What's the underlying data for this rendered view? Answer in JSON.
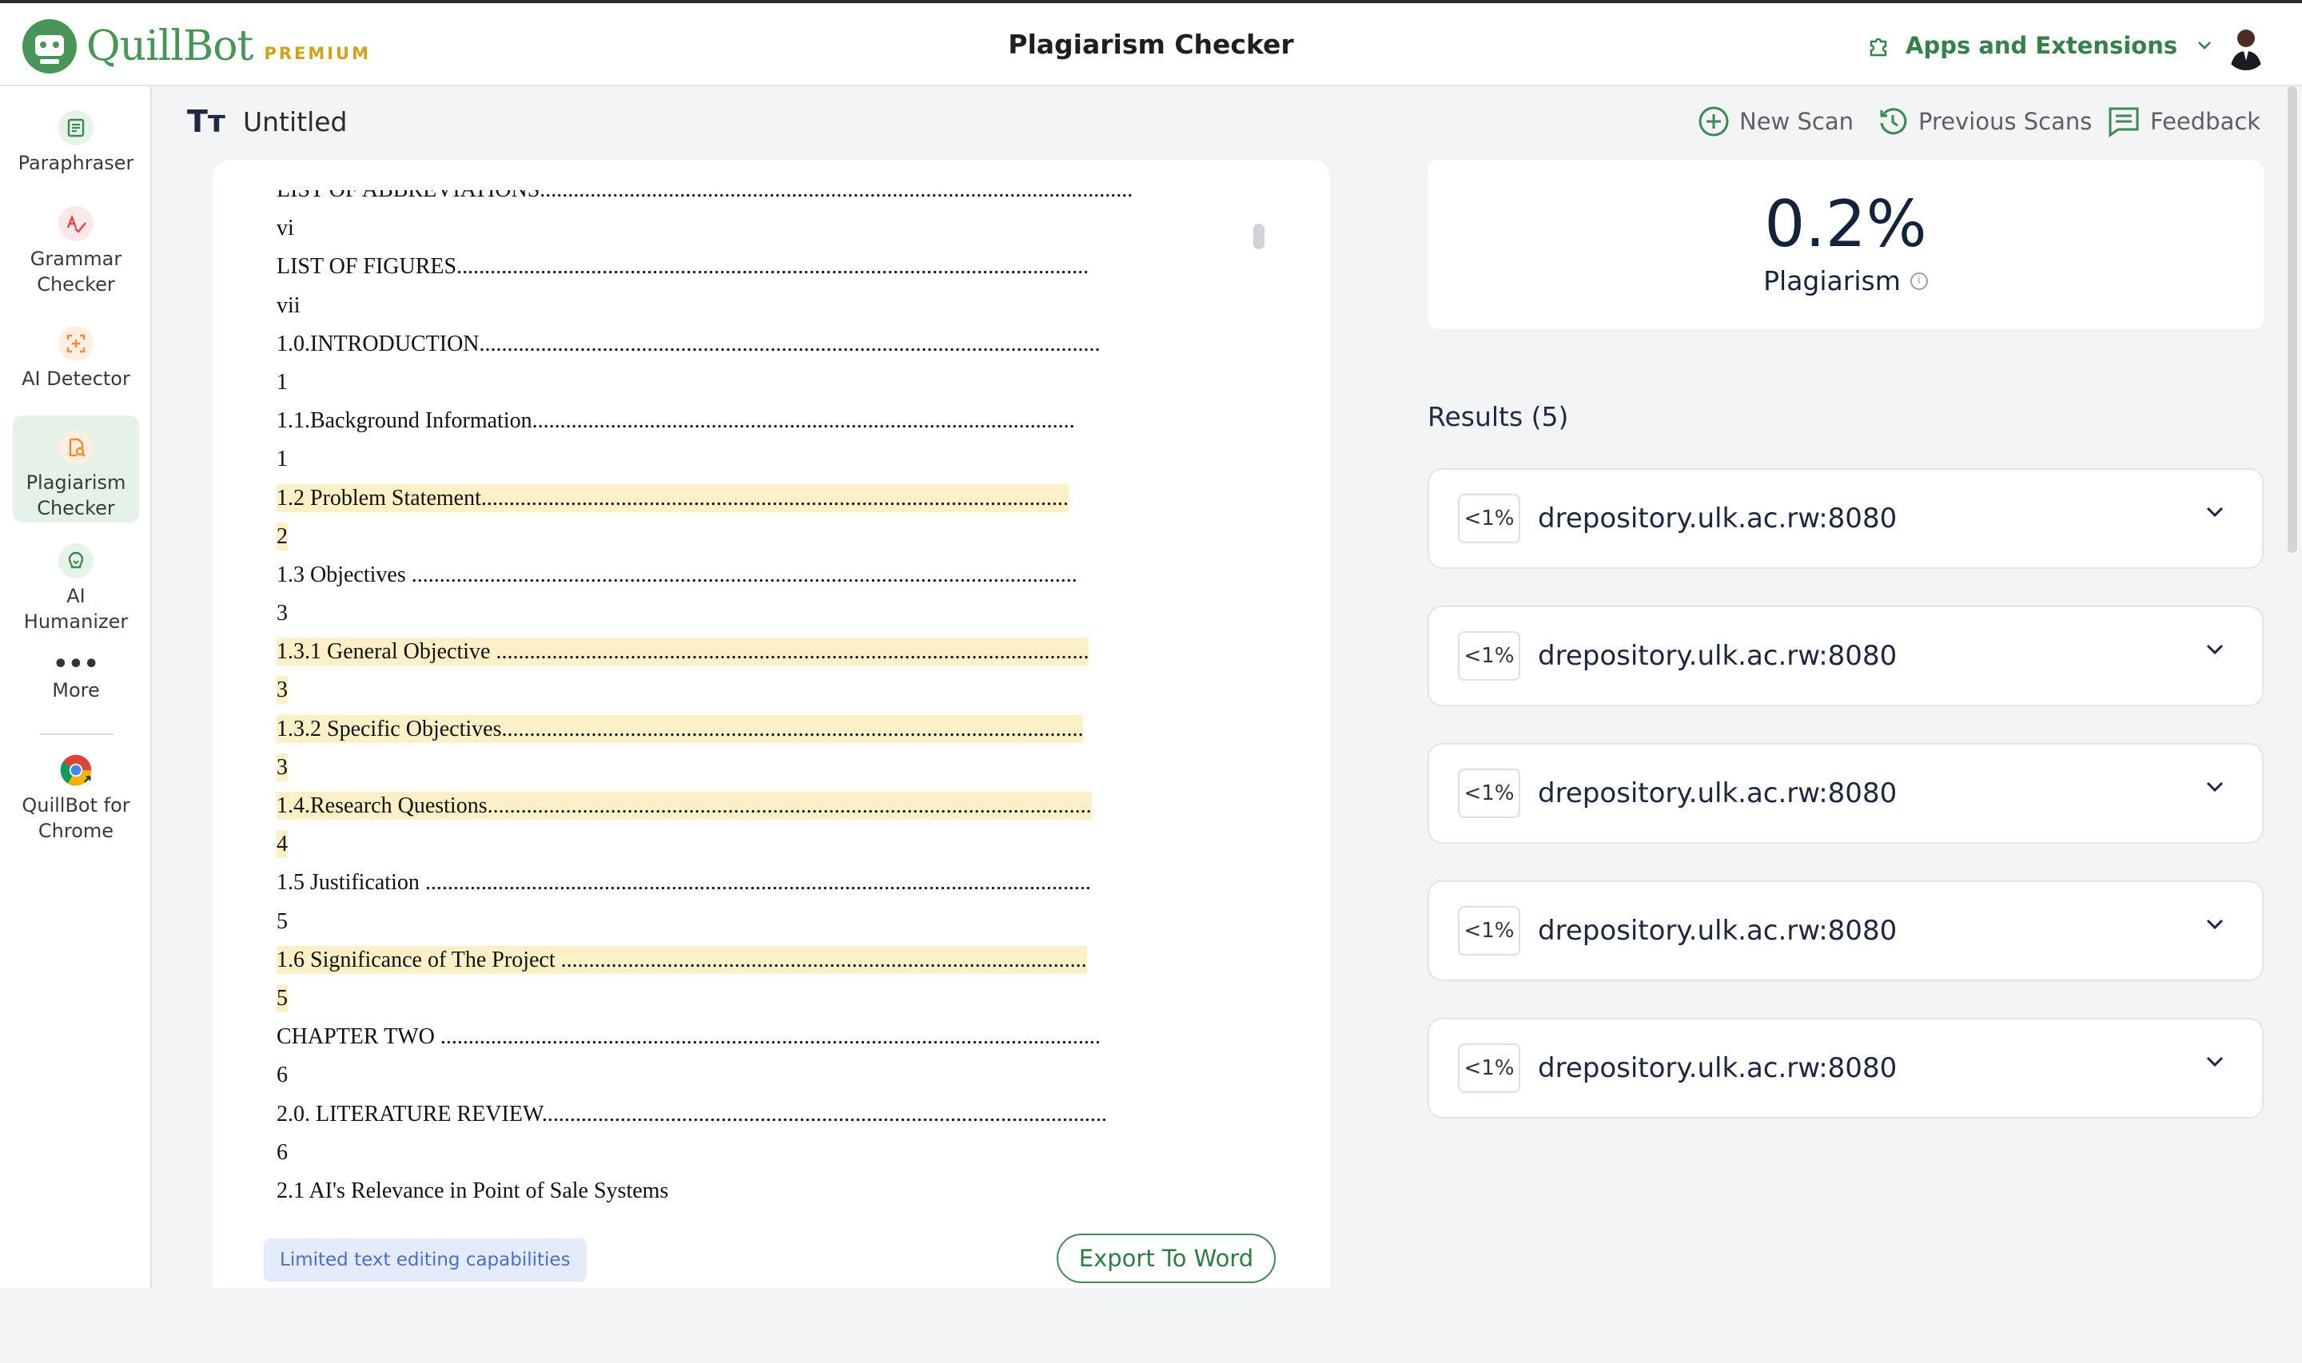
{
  "app": {
    "brand": "QuillBot",
    "premium": "PREMIUM",
    "page_title": "Plagiarism Checker",
    "apps_label": "Apps and Extensions"
  },
  "sidebar": {
    "items": [
      {
        "label": "Paraphraser",
        "icon": "paraphraser-icon"
      },
      {
        "label": "Grammar Checker",
        "icon": "grammar-checker-icon"
      },
      {
        "label": "AI Detector",
        "icon": "ai-detector-icon"
      },
      {
        "label": "Plagiarism Checker",
        "icon": "plagiarism-checker-icon",
        "active": true
      },
      {
        "label": "AI Humanizer",
        "icon": "ai-humanizer-icon"
      },
      {
        "label": "More",
        "icon": "more-dots-icon"
      },
      {
        "label": "QuillBot for Chrome",
        "icon": "chrome-icon"
      }
    ]
  },
  "document": {
    "title_icon": "Tт",
    "title": "Untitled",
    "lines": [
      {
        "text": "LIST OF ABBREVIATIONS..........................................................................................................",
        "hl": false
      },
      {
        "text": "vi",
        "hl": false
      },
      {
        "text": "LIST OF FIGURES.................................................................................................................",
        "hl": false
      },
      {
        "text": "vii",
        "hl": false
      },
      {
        "text": "1.0.INTRODUCTION...............................................................................................................",
        "hl": false
      },
      {
        "text": "1",
        "hl": false
      },
      {
        "text": "1.1.Background Information.................................................................................................",
        "hl": false
      },
      {
        "text": "1",
        "hl": false
      },
      {
        "text": "1.2 Problem Statement.........................................................................................................",
        "hl": true
      },
      {
        "text": "2",
        "hl": true
      },
      {
        "text": "1.3 Objectives .......................................................................................................................",
        "hl": false
      },
      {
        "text": "3",
        "hl": false
      },
      {
        "text": "1.3.1 General Objective ..........................................................................................................",
        "hl": true
      },
      {
        "text": "3",
        "hl": true
      },
      {
        "text": "1.3.2 Specific Objectives........................................................................................................",
        "hl": true
      },
      {
        "text": "3",
        "hl": true
      },
      {
        "text": "1.4.Research Questions............................................................................................................",
        "hl": true
      },
      {
        "text": "4",
        "hl": true
      },
      {
        "text": "1.5 Justification .......................................................................................................................",
        "hl": false
      },
      {
        "text": "5",
        "hl": false
      },
      {
        "text": "1.6 Significance of The Project ..............................................................................................",
        "hl": true
      },
      {
        "text": "5",
        "hl": true
      },
      {
        "text": "CHAPTER TWO ......................................................................................................................",
        "hl": false
      },
      {
        "text": "6",
        "hl": false
      },
      {
        "text": "2.0. LITERATURE REVIEW.....................................................................................................",
        "hl": false
      },
      {
        "text": "6",
        "hl": false
      },
      {
        "text": "2.1 AI's Relevance in Point of Sale Systems",
        "hl": false
      }
    ],
    "limited_note": "Limited text editing capabilities",
    "export_label": "Export To Word"
  },
  "toolbar": {
    "new_scan": "New Scan",
    "previous_scans": "Previous Scans",
    "feedback": "Feedback"
  },
  "score": {
    "value": "0.2%",
    "label": "Plagiarism"
  },
  "results": {
    "title": "Results (5)",
    "items": [
      {
        "pct": "<1%",
        "source": "drepository.ulk.ac.rw:8080"
      },
      {
        "pct": "<1%",
        "source": "drepository.ulk.ac.rw:8080"
      },
      {
        "pct": "<1%",
        "source": "drepository.ulk.ac.rw:8080"
      },
      {
        "pct": "<1%",
        "source": "drepository.ulk.ac.rw:8080"
      },
      {
        "pct": "<1%",
        "source": "drepository.ulk.ac.rw:8080"
      }
    ]
  },
  "colors": {
    "brand_green": "#499557",
    "highlight": "#fbf0c6",
    "premium_gold": "#d4a017"
  }
}
